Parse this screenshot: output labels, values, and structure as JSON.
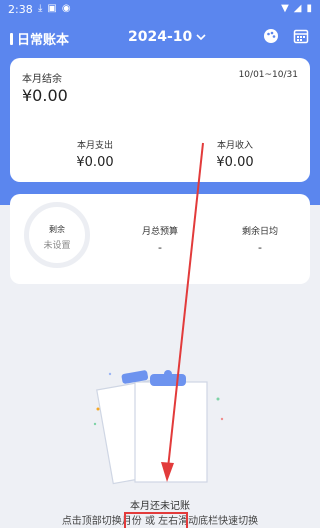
{
  "status_bar": {
    "time": "2:38",
    "battery_icon": "battery-icon",
    "wifi_icon": "wifi-icon"
  },
  "app_bar": {
    "title": "日常账本",
    "month": "2024-10",
    "icons": [
      "palette-icon",
      "calendar-icon"
    ]
  },
  "balance": {
    "label": "本月结余",
    "range": "10/01~10/31",
    "value": "¥0.00",
    "expense_label": "本月支出",
    "expense_value": "¥0.00",
    "income_label": "本月收入",
    "income_value": "¥0.00"
  },
  "budget": {
    "ring_label": "剩余",
    "ring_value": "未设置",
    "total_label": "月总预算",
    "total_value": "-",
    "daily_label": "剩余日均",
    "daily_value": "-"
  },
  "empty": {
    "title": "本月还未记账",
    "hint": "点击顶部切换月份 或 左右滑动底栏快速切换"
  },
  "colors": {
    "header": "#5b86ee",
    "annotation": "#e23b3b",
    "background": "#eef0f5"
  }
}
